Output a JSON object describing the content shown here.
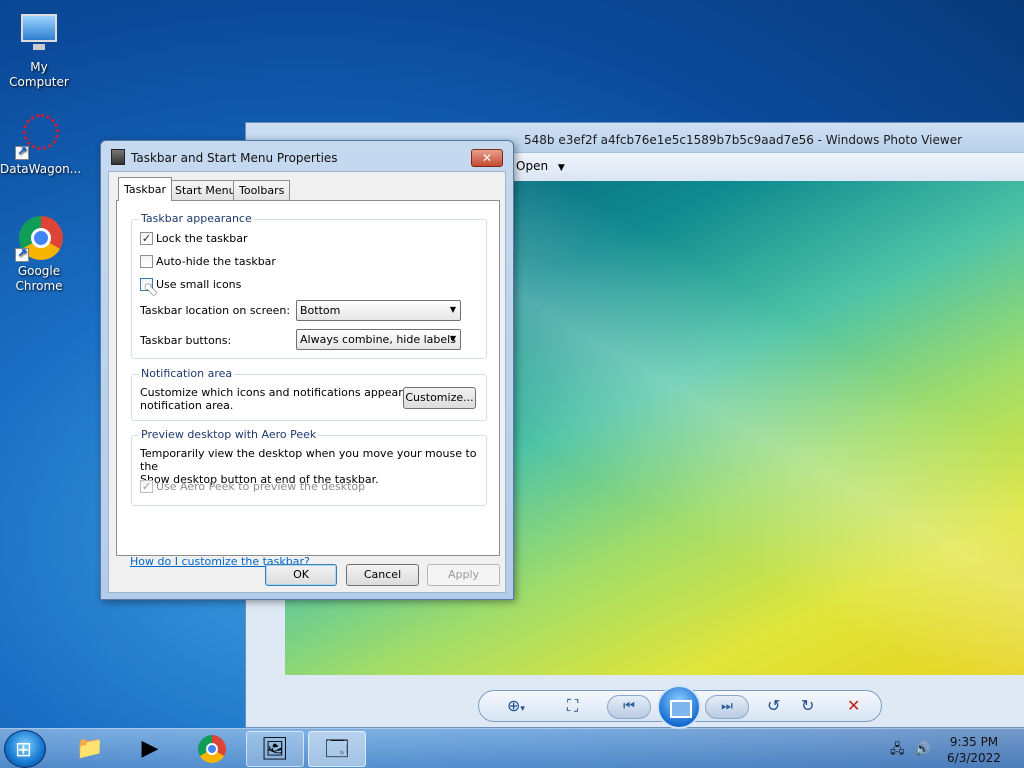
{
  "desktop": {
    "icons": [
      {
        "label": "My Computer"
      },
      {
        "label": "DataWagon..."
      },
      {
        "label": "Google Chrome"
      }
    ]
  },
  "photo_viewer": {
    "title": "548b e3ef2f a4fcb76e1e5c1589b7b5c9aad7e56 - Windows Photo Viewer",
    "menu_open": "Open"
  },
  "dialog": {
    "title": "Taskbar and Start Menu Properties",
    "close_label": "✕",
    "tabs": [
      {
        "label": "Taskbar"
      },
      {
        "label": "Start Menu"
      },
      {
        "label": "Toolbars"
      }
    ],
    "appearance": {
      "group_label": "Taskbar appearance",
      "lock_label": "Lock the taskbar",
      "autohide_label": "Auto-hide the taskbar",
      "small_icons_label": "Use small icons",
      "location_label": "Taskbar location on screen:",
      "location_value": "Bottom",
      "buttons_label": "Taskbar buttons:",
      "buttons_value": "Always combine, hide labels"
    },
    "notification": {
      "group_label": "Notification area",
      "text_line1": "Customize which icons and notifications appear in the",
      "text_line2": "notification area.",
      "customize_label": "Customize..."
    },
    "aero": {
      "group_label": "Preview desktop with Aero Peek",
      "text_line1": "Temporarily view the desktop when you move your mouse to the",
      "text_line2": "Show desktop button at end of the taskbar.",
      "checkbox_label": "Use Aero Peek to preview the desktop"
    },
    "help_link": "How do I customize the taskbar?",
    "ok_label": "OK",
    "cancel_label": "Cancel",
    "apply_label": "Apply"
  },
  "taskbar": {
    "time": "9:35 PM",
    "date": "6/3/2022"
  }
}
